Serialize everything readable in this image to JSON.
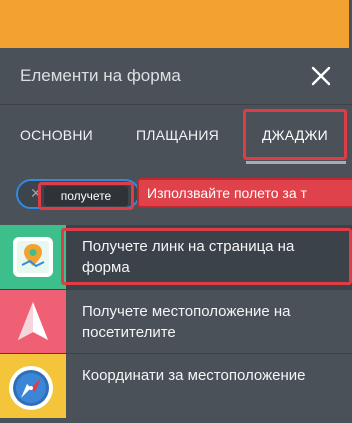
{
  "panel": {
    "title": "Елементи на форма"
  },
  "tabs": [
    {
      "label": "ОСНОВНИ",
      "active": false
    },
    {
      "label": "ПЛАЩАНИЯ",
      "active": false
    },
    {
      "label": "ДЖАДЖИ",
      "active": true
    }
  ],
  "search": {
    "chip": "получете",
    "tooltip": "Използвайте полето за т"
  },
  "widgets": [
    {
      "label": "Получете линк на страница на форма",
      "icon": "page-link-pin-icon",
      "icon_bg": "#3dbf8c"
    },
    {
      "label": "Получете местоположение на посетителите",
      "icon": "location-arrow-icon",
      "icon_bg": "#f06075"
    },
    {
      "label": "Координати за местоположение",
      "icon": "compass-icon",
      "icon_bg": "#f4c53b"
    }
  ],
  "colors": {
    "accent_orange": "#f2a230",
    "panel_bg": "#4a5158",
    "highlight_red": "#e03c45",
    "search_border": "#2f8ae0"
  }
}
